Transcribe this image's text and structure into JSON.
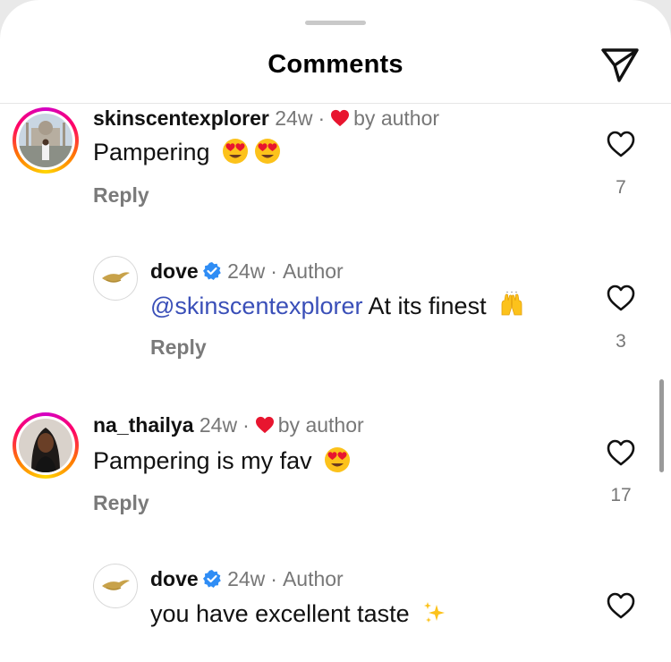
{
  "header": {
    "title": "Comments"
  },
  "comments": [
    {
      "username": "skinscentexplorer",
      "time": "24w",
      "liked_by": "by author",
      "text": "Pampering",
      "reply_label": "Reply",
      "likes": "7"
    },
    {
      "username": "dove",
      "time": "24w",
      "role": "Author",
      "mention": "@skinscentexplorer",
      "text": "At its finest",
      "reply_label": "Reply",
      "likes": "3"
    },
    {
      "username": "na_thailya",
      "time": "24w",
      "liked_by": "by author",
      "text": "Pampering is my fav",
      "reply_label": "Reply",
      "likes": "17"
    },
    {
      "username": "dove",
      "time": "24w",
      "role": "Author",
      "text": "you have excellent taste"
    }
  ],
  "icons": {
    "send": "paper-plane-icon",
    "like": "heart-outline-icon",
    "liked_by_author": "red-heart-icon",
    "verified": "verified-badge-icon",
    "emoji_heart_eyes": "heart-eyes-emoji",
    "emoji_raised_hands": "raised-hands-emoji",
    "emoji_sparkles": "sparkles-emoji"
  },
  "colors": {
    "mention": "#3a4fb8",
    "verified": "#2f8df5",
    "heart_red": "#e8152f",
    "secondary_text": "#777777"
  }
}
